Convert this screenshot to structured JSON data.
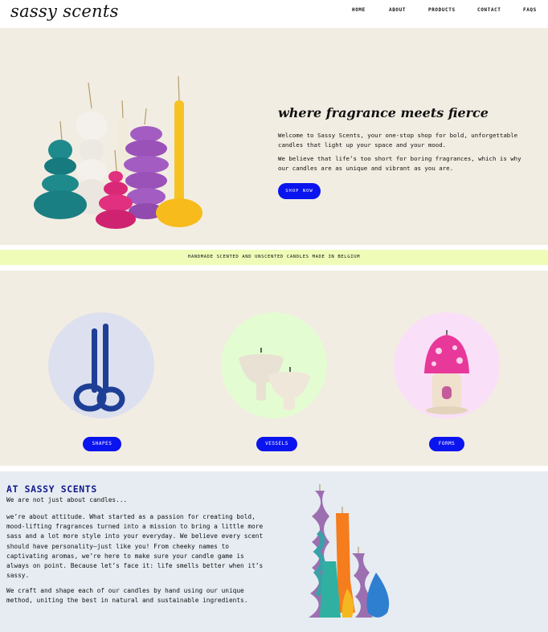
{
  "brand": {
    "logo_text": "sassy scents"
  },
  "nav": {
    "home": "HOME",
    "about": "ABOUT",
    "products": "PRODUCTS",
    "contact": "CONTACT",
    "faqs": "FAQS"
  },
  "hero": {
    "title": "where fragrance meets fierce",
    "paragraph1": "Welcome to Sassy Scents, your one-stop shop for bold, unforgettable candles that light up your space and your mood.",
    "paragraph2": "We believe that life’s too short for boring fragrances, which is why our candles are as unique and vibrant as you are.",
    "button_label": "SHOP NOW"
  },
  "ribbon": {
    "text": "HANDMADE SCENTED AND UNSCENTED CANDLES MADE IN BELGIUM"
  },
  "categories": [
    {
      "label": "SHAPES",
      "circle_color": "#dde0ee"
    },
    {
      "label": "VESSELS",
      "circle_color": "#e4fcd2"
    },
    {
      "label": "FORMS",
      "circle_color": "#fadff8"
    }
  ],
  "about": {
    "title": "AT SASSY SCENTS",
    "subtitle": "We are not just about candles...",
    "paragraph1": "we’re about attitude. What started as a passion for creating bold, mood-lifting fragrances turned into a mission to bring a little more sass and a lot more style into your everyday. We believe every scent should have personality—just like you! From cheeky names to captivating aromas, we’re here to make sure your candle game is always on point. Because let’s face it: life smells better when it’s sassy.",
    "paragraph2": "We craft and shape each of our candles by hand using our unique method, uniting the best in natural and sustainable ingredients."
  },
  "colors": {
    "accent": "#0a14ee",
    "cream": "#f2ede2",
    "lime": "#eefcb8",
    "about_bg": "#e6ecf2",
    "about_title": "#131a8a"
  }
}
